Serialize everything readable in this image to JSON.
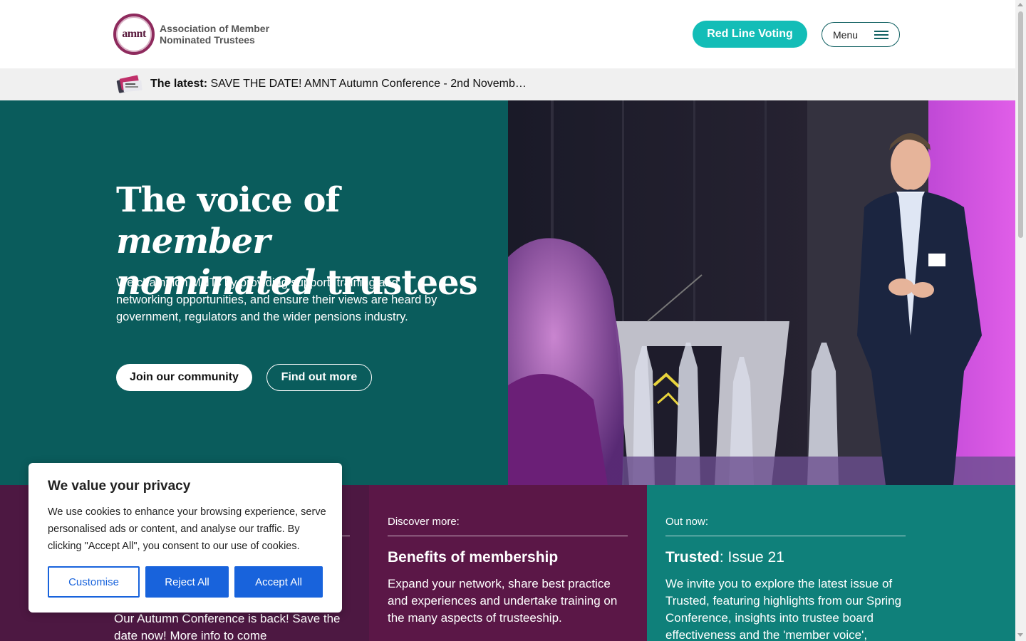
{
  "header": {
    "logo_mark": "amnt",
    "logo_line1": "Association of Member",
    "logo_line2": "Nominated Trustees",
    "cta_label": "Red Line Voting",
    "menu_label": "Menu"
  },
  "latest": {
    "prefix": "The latest:",
    "headline": "SAVE THE DATE! AMNT Autumn Conference - 2nd Novemb…",
    "icon": "news-thumbnail-icon"
  },
  "hero": {
    "title_part1": "The voice of ",
    "title_italic1": "member",
    "title_italic2": "nominated",
    "title_part2": " trustees",
    "description": "We champion MNTs by providing support, training and networking opportunities, and ensure their views are heard by government, regulators and the wider pensions industry.",
    "primary_button": "Join our community",
    "secondary_button": "Find out more"
  },
  "cards": [
    {
      "kicker": "",
      "title": "",
      "body": "Our Autumn Conference is back! Save the date now! More info to come"
    },
    {
      "kicker": "Discover more:",
      "title": "Benefits of membership",
      "body": "Expand your network, share best practice and experiences and undertake training on the many aspects of trusteeship."
    },
    {
      "kicker": "Out now:",
      "title_bold": "Trusted",
      "title_rest": ": Issue 21",
      "body": "We invite you to explore the latest issue of Trusted, featuring highlights from our Spring Conference, insights into trustee board effectiveness and the 'member voice',"
    }
  ],
  "cookie": {
    "title": "We value your privacy",
    "text": "We use cookies to enhance your browsing experience, serve personalised ads or content, and analyse our traffic. By clicking \"Accept All\", you consent to our use of cookies.",
    "customise": "Customise",
    "reject": "Reject All",
    "accept": "Accept All"
  },
  "colors": {
    "teal_dark": "#0a5c5c",
    "teal_button": "#13bdb7",
    "plum": "#5b1747",
    "cookie_blue": "#1863dc"
  }
}
